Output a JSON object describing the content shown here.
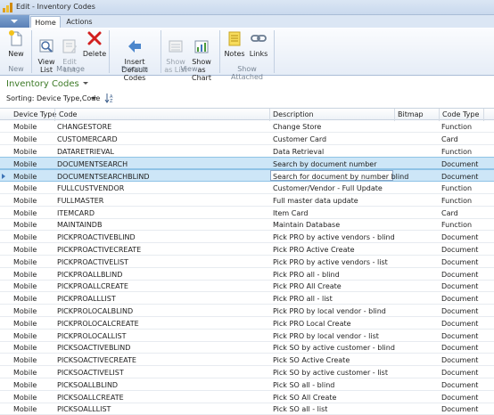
{
  "window": {
    "title": "Edit - Inventory Codes"
  },
  "tabs": {
    "home": "Home",
    "actions": "Actions"
  },
  "ribbon": {
    "new_label": "New",
    "view_list_label": "View\nList",
    "edit_list_label": "Edit\nList",
    "delete_label": "Delete",
    "insert_default_label": "Insert\nDefault Codes",
    "show_as_list_label": "Show\nas List",
    "show_as_chart_label": "Show as\nChart",
    "notes_label": "Notes",
    "links_label": "Links",
    "groups": {
      "new": "New",
      "manage": "Manage",
      "process": "Process",
      "view": "View",
      "show_attached": "Show Attached"
    }
  },
  "page": {
    "title": "Inventory Codes"
  },
  "sorting": {
    "label": "Sorting:",
    "value": "Device Type,Code"
  },
  "columns": [
    "Device Type",
    "Code",
    "Description",
    "Bitmap",
    "Code Type"
  ],
  "rows": [
    [
      "Mobile",
      "CHANGESTORE",
      "Change Store",
      "",
      "Function"
    ],
    [
      "Mobile",
      "CUSTOMERCARD",
      "Customer Card",
      "",
      "Card"
    ],
    [
      "Mobile",
      "DATARETRIEVAL",
      "Data Retrieval",
      "",
      "Function"
    ],
    [
      "Mobile",
      "DOCUMENTSEARCH",
      "Search  by document number",
      "",
      "Document"
    ],
    [
      "Mobile",
      "DOCUMENTSEARCHBLIND",
      "Search for document by number blind",
      "",
      "Document"
    ],
    [
      "Mobile",
      "FULLCUSTVENDOR",
      "Customer/Vendor - Full Update",
      "",
      "Function"
    ],
    [
      "Mobile",
      "FULLMASTER",
      "Full master data update",
      "",
      "Function"
    ],
    [
      "Mobile",
      "ITEMCARD",
      "Item Card",
      "",
      "Card"
    ],
    [
      "Mobile",
      "MAINTAINDB",
      "Maintain Database",
      "",
      "Function"
    ],
    [
      "Mobile",
      "PICKPROACTIVEBLIND",
      "Pick PRO by active vendors - blind",
      "",
      "Document"
    ],
    [
      "Mobile",
      "PICKPROACTIVECREATE",
      "Pick PRO Active Create",
      "",
      "Document"
    ],
    [
      "Mobile",
      "PICKPROACTIVELIST",
      "Pick PRO by active vendors - list",
      "",
      "Document"
    ],
    [
      "Mobile",
      "PICKPROALLBLIND",
      "Pick PRO all - blind",
      "",
      "Document"
    ],
    [
      "Mobile",
      "PICKPROALLCREATE",
      "Pick PRO All Create",
      "",
      "Document"
    ],
    [
      "Mobile",
      "PICKPROALLLIST",
      "Pick PRO all - list",
      "",
      "Document"
    ],
    [
      "Mobile",
      "PICKPROLOCALBLIND",
      "Pick PRO by local vendor - blind",
      "",
      "Document"
    ],
    [
      "Mobile",
      "PICKPROLOCALCREATE",
      "Pick PRO Local Create",
      "",
      "Document"
    ],
    [
      "Mobile",
      "PICKPROLOCALLIST",
      "Pick PRO by local vendor - list",
      "",
      "Document"
    ],
    [
      "Mobile",
      "PICKSOACTIVEBLIND",
      "Pick SO by active customer - blind",
      "",
      "Document"
    ],
    [
      "Mobile",
      "PICKSOACTIVECREATE",
      "Pick SO Active Create",
      "",
      "Document"
    ],
    [
      "Mobile",
      "PICKSOACTIVELIST",
      "Pick SO by active customer - list",
      "",
      "Document"
    ],
    [
      "Mobile",
      "PICKSOALLBLIND",
      "Pick SO all - blind",
      "",
      "Document"
    ],
    [
      "Mobile",
      "PICKSOALLCREATE",
      "Pick SO All Create",
      "",
      "Document"
    ],
    [
      "Mobile",
      "PICKSOALLLIST",
      "Pick SO all - list",
      "",
      "Document"
    ]
  ],
  "selected_rows": [
    3,
    4
  ],
  "editing_row": 4,
  "colors": {
    "accent_title": "#3c7a26",
    "selection": "#cde6f7",
    "ribbon_bg": "#e6edf7"
  }
}
